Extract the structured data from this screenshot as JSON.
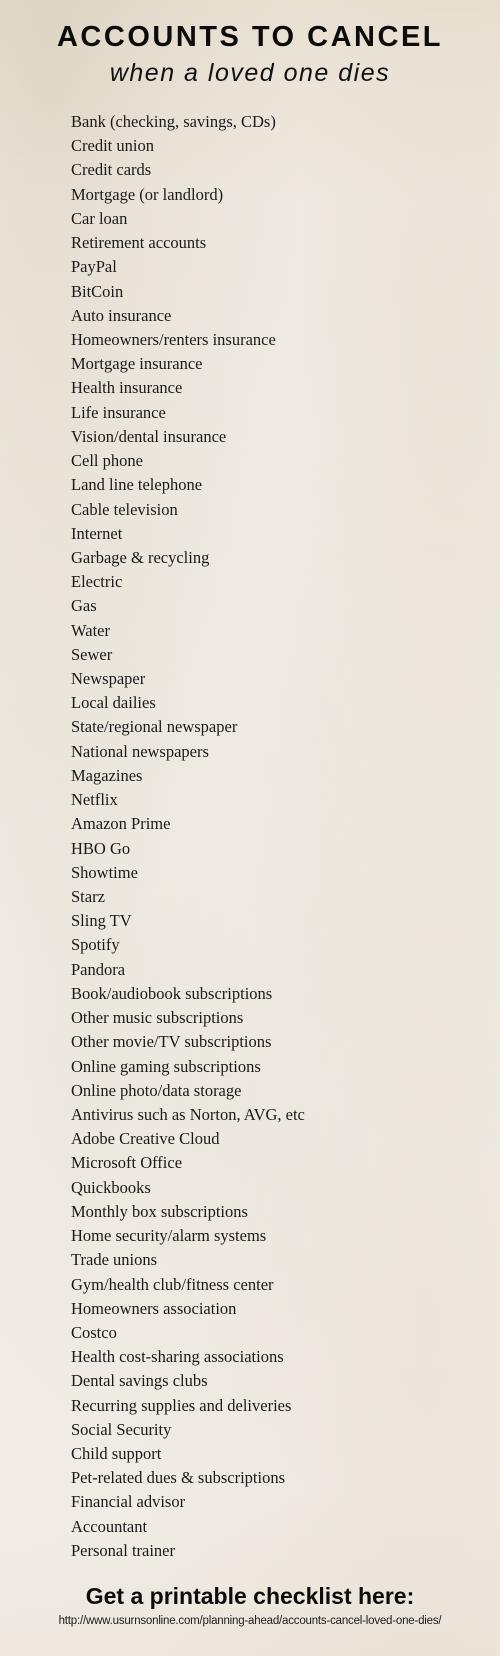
{
  "header": {
    "title": "ACCOUNTS TO CANCEL",
    "subtitle": "when a loved one dies"
  },
  "accounts": [
    "Bank (checking, savings, CDs)",
    "Credit union",
    "Credit cards",
    "Mortgage (or landlord)",
    "Car loan",
    "Retirement accounts",
    "PayPal",
    "BitCoin",
    "Auto insurance",
    "Homeowners/renters insurance",
    "Mortgage insurance",
    "Health insurance",
    "Life insurance",
    "Vision/dental insurance",
    "Cell phone",
    "Land line telephone",
    "Cable television",
    "Internet",
    "Garbage & recycling",
    "Electric",
    "Gas",
    "Water",
    "Sewer",
    "Newspaper",
    "Local dailies",
    "State/regional newspaper",
    "National newspapers",
    "Magazines",
    "Netflix",
    "Amazon Prime",
    "HBO Go",
    "Showtime",
    "Starz",
    "Sling TV",
    "Spotify",
    "Pandora",
    "Book/audiobook subscriptions",
    "Other music subscriptions",
    "Other movie/TV subscriptions",
    "Online gaming subscriptions",
    "Online photo/data storage",
    "Antivirus such as Norton, AVG, etc",
    "Adobe Creative Cloud",
    "Microsoft Office",
    "Quickbooks",
    "Monthly box subscriptions",
    "Home security/alarm systems",
    "Trade unions",
    "Gym/health club/fitness center",
    "Homeowners association",
    "Costco",
    "Health cost-sharing associations",
    "Dental savings clubs",
    "Recurring supplies and deliveries",
    "Social Security",
    "Child support",
    "Pet-related dues & subscriptions",
    "Financial advisor",
    "Accountant",
    "Personal trainer"
  ],
  "footer": {
    "cta": "Get a printable checklist here:",
    "url": "http://www.usurnsonline.com/planning-ahead/accounts-cancel-loved-one-dies/"
  }
}
